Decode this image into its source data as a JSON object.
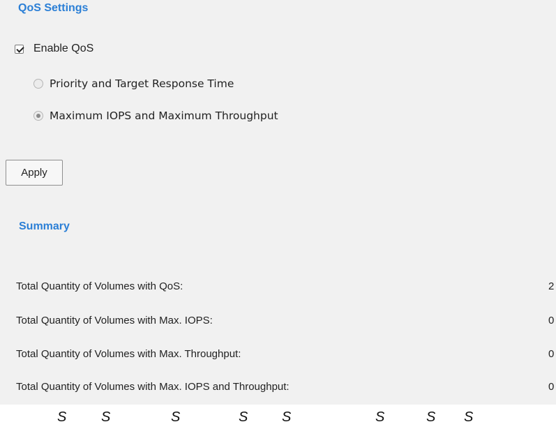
{
  "qos_settings": {
    "title": "QoS Settings",
    "enable_checkbox": {
      "label": "Enable QoS",
      "checked": true
    },
    "modes": [
      {
        "label": "Priority and Target Response Time",
        "selected": false
      },
      {
        "label": "Maximum IOPS and Maximum Throughput",
        "selected": true
      }
    ],
    "apply_label": "Apply"
  },
  "summary": {
    "title": "Summary",
    "rows": [
      {
        "label": "Total Quantity of Volumes with QoS:",
        "value": "2"
      },
      {
        "label": "Total Quantity of Volumes with Max. IOPS:",
        "value": "0"
      },
      {
        "label": "Total Quantity of Volumes with Max. Throughput:",
        "value": "0"
      },
      {
        "label": "Total Quantity of Volumes with Max. IOPS and Throughput:",
        "value": "0"
      }
    ]
  },
  "footer_glyphs": [
    "S",
    "S",
    "S",
    "S",
    "S",
    "S",
    "S",
    "S"
  ],
  "colors": {
    "section_title": "#2b7fd6",
    "panel_background": "#f1f1f1",
    "page_background": "#ffffff"
  }
}
